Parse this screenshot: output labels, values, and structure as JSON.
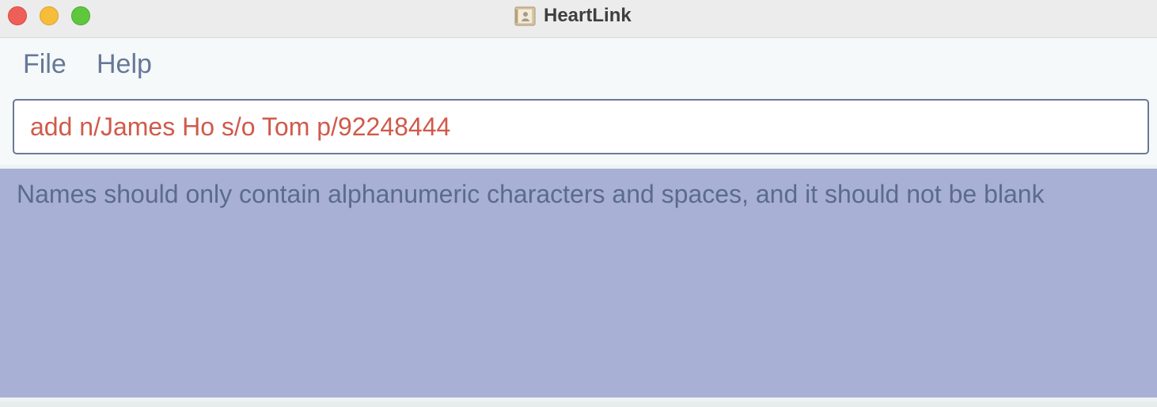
{
  "window": {
    "title": "HeartLink",
    "app_icon": "contacts-app-icon",
    "controls": {
      "close": "close-window",
      "minimize": "minimize-window",
      "zoom": "zoom-window"
    }
  },
  "menu": {
    "items": [
      {
        "label": "File"
      },
      {
        "label": "Help"
      }
    ]
  },
  "command": {
    "value": "add n/James Ho s/o Tom p/92248444"
  },
  "result": {
    "message": "Names should only contain alphanumeric characters and spaces, and it should not be blank"
  },
  "colors": {
    "command_text": "#d05a4b",
    "result_background": "#a8b0d6",
    "result_text": "#5b6b8e",
    "menu_text": "#65789a"
  }
}
